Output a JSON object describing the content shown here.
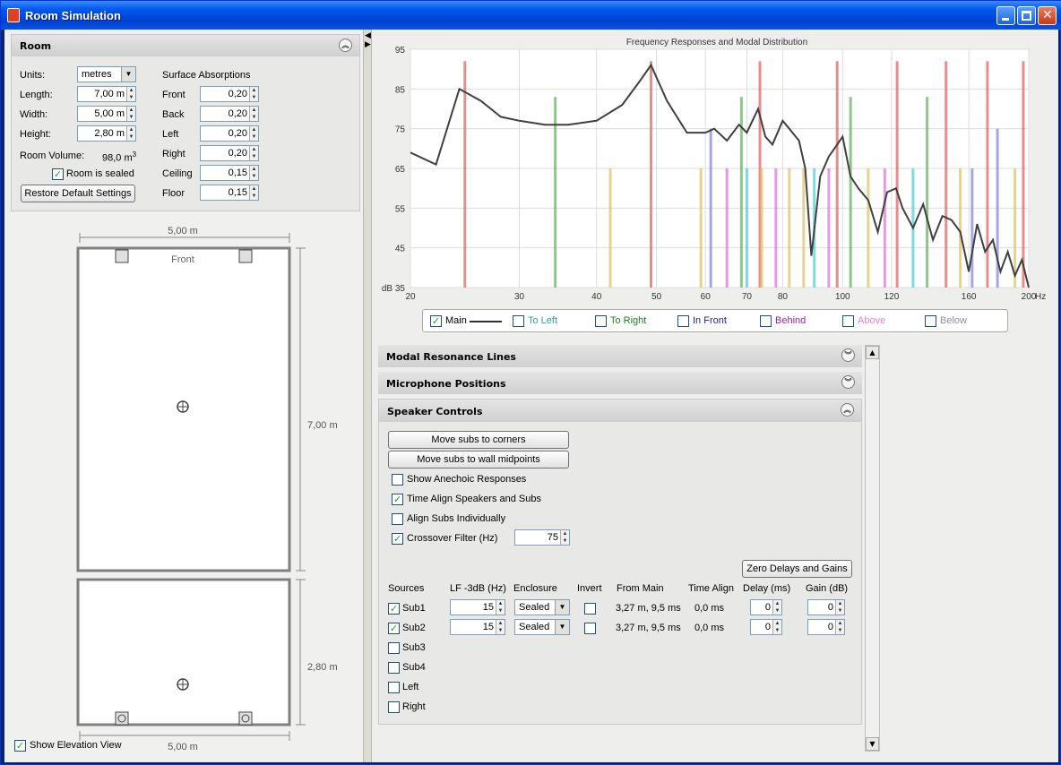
{
  "window": {
    "title": "Room Simulation"
  },
  "room": {
    "header": "Room",
    "units_label": "Units:",
    "units_value": "metres",
    "length_label": "Length:",
    "length_value": "7,00 m",
    "width_label": "Width:",
    "width_value": "5,00 m",
    "height_label": "Height:",
    "height_value": "2,80 m",
    "volume_label": "Room Volume:",
    "volume_value": "98,0 m",
    "volume_sup": "3",
    "sealed_label": "Room is sealed",
    "restore_label": "Restore Default Settings",
    "absorptions_title": "Surface Absorptions",
    "absorptions": [
      {
        "label": "Front",
        "value": "0,20"
      },
      {
        "label": "Back",
        "value": "0,20"
      },
      {
        "label": "Left",
        "value": "0,20"
      },
      {
        "label": "Right",
        "value": "0,20"
      },
      {
        "label": "Ceiling",
        "value": "0,15"
      },
      {
        "label": "Floor",
        "value": "0,15"
      }
    ]
  },
  "plan": {
    "width_dim": "5,00 m",
    "length_dim": "7,00 m",
    "front_label": "Front",
    "elev_height_dim": "2,80 m",
    "elev_width_dim": "5,00 m",
    "show_elevation_label": "Show Elevation View"
  },
  "chart_data": {
    "type": "line",
    "title": "Frequency Responses and Modal Distribution",
    "ylabel": "dB",
    "xlabel": "Hz",
    "x_scale": "log",
    "xlim": [
      20,
      200
    ],
    "ylim": [
      35,
      95
    ],
    "x_ticks": [
      20,
      30,
      40,
      50,
      60,
      70,
      80,
      100,
      120,
      160,
      200
    ],
    "y_ticks": [
      35,
      45,
      55,
      65,
      75,
      85,
      95
    ],
    "grid": true,
    "series": [
      {
        "name": "Main",
        "color": "#404040",
        "x": [
          20,
          22,
          24,
          26,
          28,
          30,
          33,
          36,
          40,
          44,
          47,
          49,
          52,
          56,
          60,
          62,
          65,
          68,
          70,
          73,
          75,
          77,
          80,
          82,
          85,
          87,
          89,
          92,
          95,
          97,
          100,
          103,
          106,
          110,
          114,
          118,
          122,
          125,
          130,
          135,
          140,
          145,
          150,
          155,
          160,
          165,
          170,
          175,
          180,
          185,
          190,
          195,
          200
        ],
        "y": [
          69,
          66,
          85,
          82,
          78,
          77,
          76,
          76,
          77,
          81,
          87,
          91,
          82,
          74,
          74,
          75,
          72,
          76,
          74,
          80,
          73,
          71,
          77,
          75,
          72,
          65,
          43,
          63,
          68,
          70,
          73,
          63,
          60,
          57,
          49,
          59,
          60,
          55,
          50,
          56,
          47,
          53,
          52,
          49,
          39,
          51,
          44,
          47,
          39,
          44,
          38,
          42,
          35
        ]
      },
      {
        "name": "To Left",
        "color": "#2ca0a0",
        "x": [],
        "y": []
      },
      {
        "name": "To Right",
        "color": "#208020",
        "x": [],
        "y": []
      },
      {
        "name": "In Front",
        "color": "#2020a0",
        "x": [],
        "y": []
      },
      {
        "name": "Behind",
        "color": "#a020a0",
        "x": [],
        "y": []
      },
      {
        "name": "Above",
        "color": "#e080e0",
        "x": [],
        "y": []
      },
      {
        "name": "Below",
        "color": "#909090",
        "x": [],
        "y": []
      }
    ],
    "modes": [
      {
        "f": 24.5,
        "level": 92,
        "color": "#e07070"
      },
      {
        "f": 34.3,
        "level": 83,
        "color": "#70b870"
      },
      {
        "f": 42.1,
        "level": 65,
        "color": "#e0c870"
      },
      {
        "f": 49.0,
        "level": 92,
        "color": "#e07070"
      },
      {
        "f": 59.0,
        "level": 65,
        "color": "#e0c870"
      },
      {
        "f": 61.2,
        "level": 75,
        "color": "#9090e0"
      },
      {
        "f": 65.0,
        "level": 65,
        "color": "#e080e0"
      },
      {
        "f": 68.6,
        "level": 83,
        "color": "#70b870"
      },
      {
        "f": 70.0,
        "level": 65,
        "color": "#60d0e0"
      },
      {
        "f": 73.5,
        "level": 92,
        "color": "#e07070"
      },
      {
        "f": 74.0,
        "level": 65,
        "color": "#e0c870"
      },
      {
        "f": 78.0,
        "level": 65,
        "color": "#e080e0"
      },
      {
        "f": 82.0,
        "level": 65,
        "color": "#e0c870"
      },
      {
        "f": 86.5,
        "level": 65,
        "color": "#e0c870"
      },
      {
        "f": 90.0,
        "level": 65,
        "color": "#60d0e0"
      },
      {
        "f": 95.0,
        "level": 65,
        "color": "#e080e0"
      },
      {
        "f": 98.0,
        "level": 92,
        "color": "#e07070"
      },
      {
        "f": 103.0,
        "level": 83,
        "color": "#70b870"
      },
      {
        "f": 110.0,
        "level": 65,
        "color": "#e0c870"
      },
      {
        "f": 117.0,
        "level": 65,
        "color": "#e080e0"
      },
      {
        "f": 122.5,
        "level": 92,
        "color": "#e07070"
      },
      {
        "f": 130.0,
        "level": 65,
        "color": "#60d0e0"
      },
      {
        "f": 137.0,
        "level": 83,
        "color": "#70b870"
      },
      {
        "f": 147.0,
        "level": 92,
        "color": "#e07070"
      },
      {
        "f": 155.0,
        "level": 65,
        "color": "#e0c870"
      },
      {
        "f": 162.0,
        "level": 65,
        "color": "#9090e0"
      },
      {
        "f": 171.5,
        "level": 92,
        "color": "#e07070"
      },
      {
        "f": 178.0,
        "level": 75,
        "color": "#9090e0"
      },
      {
        "f": 190.0,
        "level": 65,
        "color": "#e0c870"
      },
      {
        "f": 196.0,
        "level": 92,
        "color": "#e07070"
      }
    ]
  },
  "legend": [
    {
      "label": "Main",
      "checked": true,
      "color": "#000000"
    },
    {
      "label": "To Left",
      "checked": false,
      "color": "#2ca0a0"
    },
    {
      "label": "To Right",
      "checked": false,
      "color": "#208020"
    },
    {
      "label": "In Front",
      "checked": false,
      "color": "#2020a0"
    },
    {
      "label": "Behind",
      "checked": false,
      "color": "#a020a0"
    },
    {
      "label": "Above",
      "checked": false,
      "color": "#e080e0"
    },
    {
      "label": "Below",
      "checked": false,
      "color": "#909090"
    }
  ],
  "sections": {
    "modal": "Modal Resonance Lines",
    "mic": "Microphone Positions",
    "speaker": "Speaker Controls"
  },
  "speaker": {
    "corners_btn": "Move subs to corners",
    "midpoints_btn": "Move subs to wall midpoints",
    "anechoic_label": "Show Anechoic Responses",
    "timealign_label": "Time Align Speakers and Subs",
    "individually_label": "Align Subs Individually",
    "crossover_label": "Crossover Filter (Hz)",
    "crossover_value": "75",
    "zero_btn": "Zero Delays and Gains",
    "headers": [
      "Sources",
      "LF -3dB (Hz)",
      "Enclosure",
      "Invert",
      "From Main",
      "Time Align",
      "Delay (ms)",
      "Gain (dB)"
    ],
    "rows": [
      {
        "name": "Sub1",
        "checked": true,
        "lf": "15",
        "enclosure": "Sealed",
        "from_main": "3,27 m, 9,5 ms",
        "time_align": "0,0 ms",
        "delay": "0",
        "gain": "0"
      },
      {
        "name": "Sub2",
        "checked": true,
        "lf": "15",
        "enclosure": "Sealed",
        "from_main": "3,27 m, 9,5 ms",
        "time_align": "0,0 ms",
        "delay": "0",
        "gain": "0"
      },
      {
        "name": "Sub3",
        "checked": false
      },
      {
        "name": "Sub4",
        "checked": false
      },
      {
        "name": "Left",
        "checked": false
      },
      {
        "name": "Right",
        "checked": false
      }
    ]
  }
}
